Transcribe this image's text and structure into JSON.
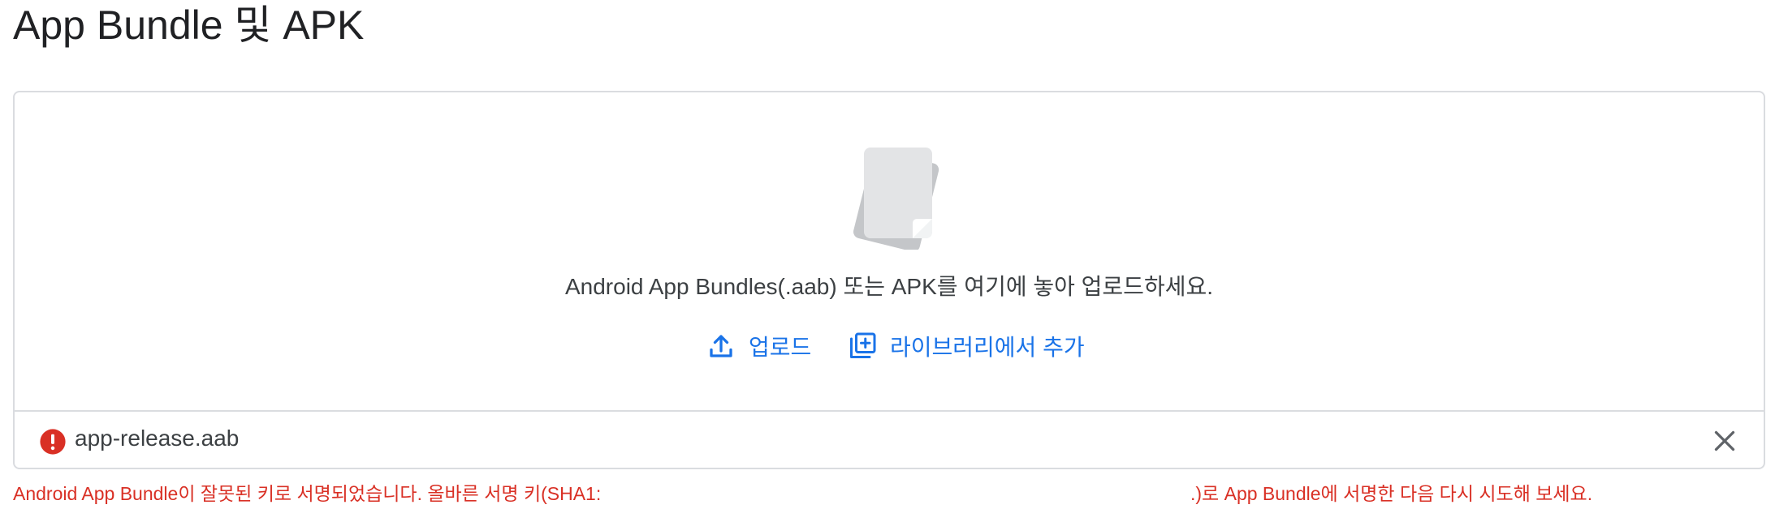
{
  "page": {
    "title": "App Bundle 및 APK"
  },
  "drop_zone": {
    "illustration_icon": "document-stack-icon",
    "instructions": "Android App Bundles(.aab) 또는 APK를 여기에 놓아 업로드하세요.",
    "upload_label": "업로드",
    "upload_icon": "upload-icon",
    "library_label": "라이브러리에서 추가",
    "library_icon": "library-add-icon"
  },
  "file": {
    "name": "app-release.aab",
    "status": "error",
    "status_icon": "error-icon",
    "remove_icon": "close-icon"
  },
  "error": {
    "message_start": "Android App Bundle이 잘못된 키로 서명되었습니다. 올바른 서명 키(SHA1:",
    "message_end": ".)로 App Bundle에 서명한 다음 다시 시도해 보세요."
  },
  "colors": {
    "accent": "#1a73e8",
    "error": "#d93025",
    "border": "#dadce0",
    "text": "#202124"
  }
}
